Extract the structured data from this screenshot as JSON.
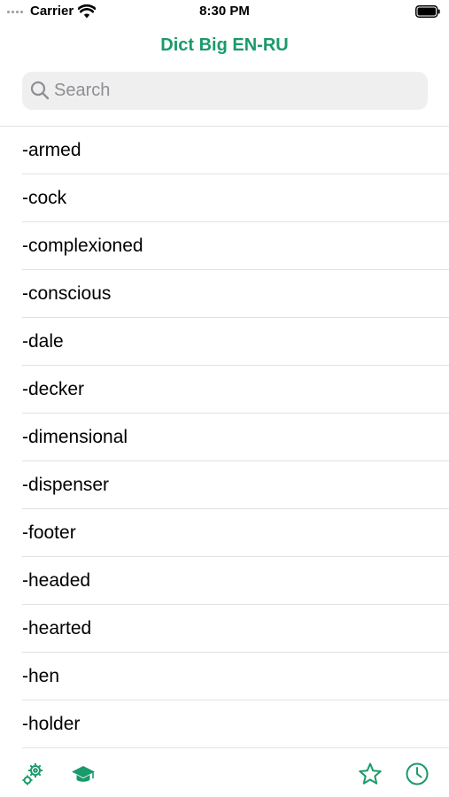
{
  "status_bar": {
    "carrier": "Carrier",
    "time": "8:30 PM"
  },
  "header": {
    "title": "Dict Big EN-RU"
  },
  "search": {
    "placeholder": "Search",
    "value": ""
  },
  "words": [
    "-armed",
    "-cock",
    "-complexioned",
    "-conscious",
    "-dale",
    "-decker",
    "-dimensional",
    "-dispenser",
    "-footer",
    "-headed",
    "-hearted",
    "-hen",
    "-holder"
  ],
  "tab_bar": {
    "icons": [
      "settings-icon",
      "study-icon",
      "favorites-icon",
      "history-icon"
    ]
  },
  "colors": {
    "accent": "#1a9a6a",
    "separator": "#e2e2e4",
    "search_bg": "#efeff0",
    "placeholder": "#8e8e93"
  }
}
